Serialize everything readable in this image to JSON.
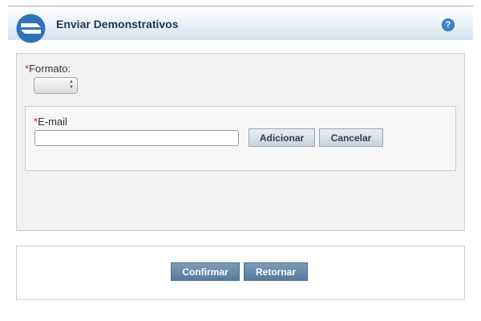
{
  "header": {
    "title": "Enviar Demonstrativos",
    "help_label": "?"
  },
  "form": {
    "required_mark": "*",
    "formato_label": "Formato:",
    "formato_selected": "",
    "email_label": "E-mail",
    "email_value": "",
    "email_placeholder": "",
    "add_button": "Adicionar",
    "cancel_button": "Cancelar"
  },
  "actions": {
    "confirm_button": "Confirmar",
    "return_button": "Retornar"
  },
  "icons": {
    "logo": "app-logo-icon",
    "help": "help-icon",
    "select_arrows": "spinner-arrows-icon"
  },
  "colors": {
    "accent_blue": "#3d86cf",
    "primary_button": "#587a9c",
    "required": "#cc2222",
    "title": "#1f3550"
  }
}
